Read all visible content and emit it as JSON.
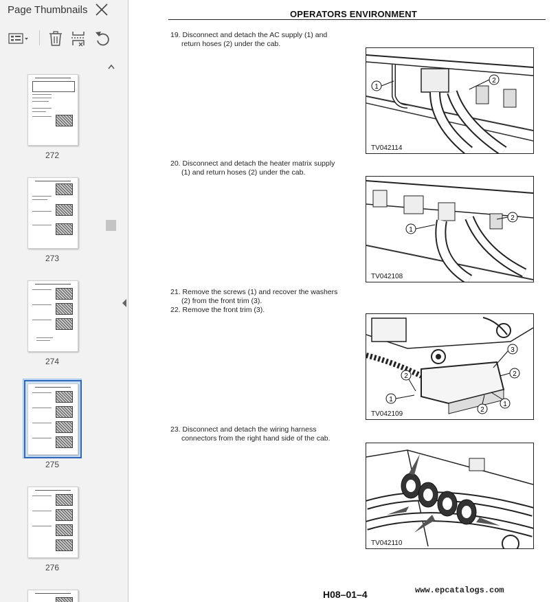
{
  "sidebar": {
    "title": "Page Thumbnails",
    "thumbnails": [
      {
        "page": "272",
        "selected": false
      },
      {
        "page": "273",
        "selected": false
      },
      {
        "page": "274",
        "selected": false
      },
      {
        "page": "275",
        "selected": true
      },
      {
        "page": "276",
        "selected": false
      }
    ]
  },
  "icons": {
    "close": "close-icon",
    "options": "thumbnail-options-icon",
    "delete": "trash-icon",
    "extract": "page-extract-icon",
    "rotate": "rotate-icon",
    "scroll_up": "chevron-up-icon",
    "collapse": "chevron-left-icon"
  },
  "document": {
    "header": "OPERATORS ENVIRONMENT",
    "steps": [
      {
        "number": "19.",
        "text_line1": "Disconnect and detach the AC supply (1) and",
        "text_line2": "return hoses (2) under the cab."
      },
      {
        "number": "20.",
        "text_line1": "Disconnect and detach the heater matrix supply",
        "text_line2": "(1) and return hoses (2) under the cab."
      },
      {
        "number": "21.",
        "text_line1": "Remove the screws (1) and recover the washers",
        "text_line2": "(2) from the front trim (3)."
      },
      {
        "number": "22.",
        "text_line1": "Remove the front trim (3).",
        "text_line2": ""
      },
      {
        "number": "23.",
        "text_line1": "Disconnect and detach the wiring harness",
        "text_line2": "connectors from the right hand side of the cab."
      }
    ],
    "figures": [
      {
        "label": "TV042114",
        "callouts": [
          "1",
          "2"
        ]
      },
      {
        "label": "TV042108",
        "callouts": [
          "1",
          "2"
        ]
      },
      {
        "label": "TV042109",
        "callouts": [
          "3",
          "2",
          "2",
          "1",
          "2",
          "1"
        ]
      },
      {
        "label": "TV042110",
        "callouts": []
      }
    ],
    "footer_code": "H08–01–4",
    "watermark": "www.epcatalogs.com"
  },
  "colors": {
    "selection": "#cde1f7",
    "selection_border": "#2c66b8",
    "sidebar_bg": "#f2f2f2"
  }
}
